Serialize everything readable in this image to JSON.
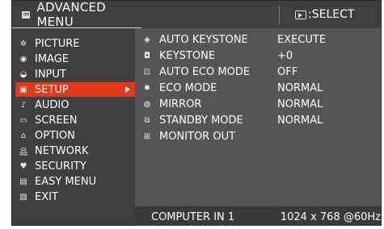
{
  "header": {
    "title": "ADVANCED MENU",
    "select_label": "SELECT"
  },
  "menu": {
    "items": [
      {
        "label": "PICTURE",
        "icon": "picture-icon"
      },
      {
        "label": "IMAGE",
        "icon": "image-icon"
      },
      {
        "label": "INPUT",
        "icon": "input-icon"
      },
      {
        "label": "SETUP",
        "icon": "setup-icon",
        "active": true
      },
      {
        "label": "AUDIO",
        "icon": "audio-icon"
      },
      {
        "label": "SCREEN",
        "icon": "screen-icon"
      },
      {
        "label": "OPTION",
        "icon": "option-icon"
      },
      {
        "label": "NETWORK",
        "icon": "network-icon"
      },
      {
        "label": "SECURITY",
        "icon": "security-icon"
      },
      {
        "label": "EASY MENU",
        "icon": "easy-menu-icon"
      },
      {
        "label": "EXIT",
        "icon": "exit-icon"
      }
    ]
  },
  "setup": {
    "rows": [
      {
        "label": "AUTO KEYSTONE",
        "value": "EXECUTE",
        "icon": "auto-keystone-icon"
      },
      {
        "label": "KEYSTONE",
        "value": "+0",
        "icon": "keystone-icon"
      },
      {
        "label": "AUTO ECO MODE",
        "value": "OFF",
        "icon": "auto-eco-mode-icon"
      },
      {
        "label": "ECO MODE",
        "value": "NORMAL",
        "icon": "eco-mode-icon"
      },
      {
        "label": "MIRROR",
        "value": "NORMAL",
        "icon": "mirror-icon"
      },
      {
        "label": "STANDBY MODE",
        "value": "NORMAL",
        "icon": "standby-mode-icon"
      },
      {
        "label": "MONITOR OUT",
        "value": "",
        "icon": "monitor-out-icon"
      }
    ]
  },
  "footer": {
    "source": "COMPUTER IN 1",
    "resolution": "1024 x 768 @60Hz"
  },
  "colors": {
    "highlight": "#e03a1a",
    "background": "#4a4a4a"
  }
}
